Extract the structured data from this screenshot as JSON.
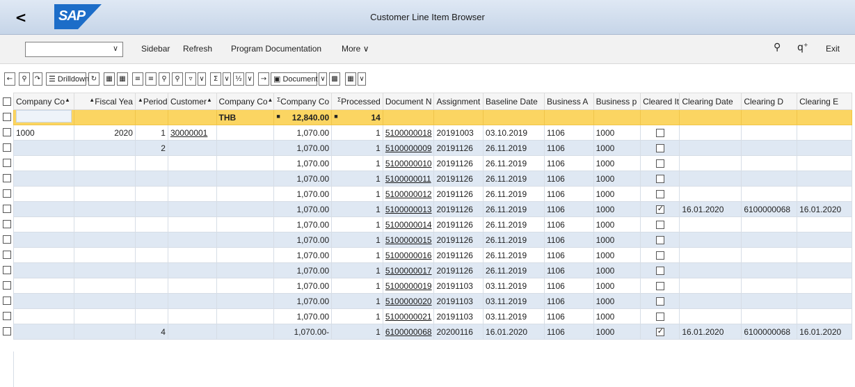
{
  "titlebar": {
    "back": "<",
    "logo": "SAP",
    "title": "Customer Line Item Browser"
  },
  "toolbar1": {
    "select_value": "",
    "sidebar": "Sidebar",
    "refresh": "Refresh",
    "program_doc": "Program Documentation",
    "more": "More",
    "exit": "Exit"
  },
  "toolbar2": {
    "drilldown": "Drilldown",
    "document": "Document"
  },
  "columns": [
    "Company Co",
    "Fiscal Yea",
    "Period",
    "Customer",
    "Company Co",
    "Company Co",
    "Processed",
    "Document N",
    "Assignment",
    "Baseline Date",
    "Business A",
    "Business p",
    "Cleared It",
    "Clearing Date",
    "Clearing D",
    "Clearing E"
  ],
  "total": {
    "currency": "THB",
    "amount": "12,840.00",
    "processed": "14"
  },
  "rows": [
    {
      "cc": "1000",
      "fy": "2020",
      "per": "1",
      "cust": "30000001",
      "amt": "1,070.00",
      "proc": "1",
      "doc": "5100000018",
      "asg": "20191003",
      "base": "03.10.2019",
      "ba": "1106",
      "bp": "1000",
      "cleared": false,
      "cdate": "",
      "cdoc": "",
      "cend": ""
    },
    {
      "cc": "",
      "fy": "",
      "per": "2",
      "cust": "",
      "amt": "1,070.00",
      "proc": "1",
      "doc": "5100000009",
      "asg": "20191126",
      "base": "26.11.2019",
      "ba": "1106",
      "bp": "1000",
      "cleared": false,
      "cdate": "",
      "cdoc": "",
      "cend": ""
    },
    {
      "cc": "",
      "fy": "",
      "per": "",
      "cust": "",
      "amt": "1,070.00",
      "proc": "1",
      "doc": "5100000010",
      "asg": "20191126",
      "base": "26.11.2019",
      "ba": "1106",
      "bp": "1000",
      "cleared": false,
      "cdate": "",
      "cdoc": "",
      "cend": ""
    },
    {
      "cc": "",
      "fy": "",
      "per": "",
      "cust": "",
      "amt": "1,070.00",
      "proc": "1",
      "doc": "5100000011",
      "asg": "20191126",
      "base": "26.11.2019",
      "ba": "1106",
      "bp": "1000",
      "cleared": false,
      "cdate": "",
      "cdoc": "",
      "cend": ""
    },
    {
      "cc": "",
      "fy": "",
      "per": "",
      "cust": "",
      "amt": "1,070.00",
      "proc": "1",
      "doc": "5100000012",
      "asg": "20191126",
      "base": "26.11.2019",
      "ba": "1106",
      "bp": "1000",
      "cleared": false,
      "cdate": "",
      "cdoc": "",
      "cend": ""
    },
    {
      "cc": "",
      "fy": "",
      "per": "",
      "cust": "",
      "amt": "1,070.00",
      "proc": "1",
      "doc": "5100000013",
      "asg": "20191126",
      "base": "26.11.2019",
      "ba": "1106",
      "bp": "1000",
      "cleared": true,
      "cdate": "16.01.2020",
      "cdoc": "6100000068",
      "cend": "16.01.2020"
    },
    {
      "cc": "",
      "fy": "",
      "per": "",
      "cust": "",
      "amt": "1,070.00",
      "proc": "1",
      "doc": "5100000014",
      "asg": "20191126",
      "base": "26.11.2019",
      "ba": "1106",
      "bp": "1000",
      "cleared": false,
      "cdate": "",
      "cdoc": "",
      "cend": ""
    },
    {
      "cc": "",
      "fy": "",
      "per": "",
      "cust": "",
      "amt": "1,070.00",
      "proc": "1",
      "doc": "5100000015",
      "asg": "20191126",
      "base": "26.11.2019",
      "ba": "1106",
      "bp": "1000",
      "cleared": false,
      "cdate": "",
      "cdoc": "",
      "cend": ""
    },
    {
      "cc": "",
      "fy": "",
      "per": "",
      "cust": "",
      "amt": "1,070.00",
      "proc": "1",
      "doc": "5100000016",
      "asg": "20191126",
      "base": "26.11.2019",
      "ba": "1106",
      "bp": "1000",
      "cleared": false,
      "cdate": "",
      "cdoc": "",
      "cend": ""
    },
    {
      "cc": "",
      "fy": "",
      "per": "",
      "cust": "",
      "amt": "1,070.00",
      "proc": "1",
      "doc": "5100000017",
      "asg": "20191126",
      "base": "26.11.2019",
      "ba": "1106",
      "bp": "1000",
      "cleared": false,
      "cdate": "",
      "cdoc": "",
      "cend": ""
    },
    {
      "cc": "",
      "fy": "",
      "per": "",
      "cust": "",
      "amt": "1,070.00",
      "proc": "1",
      "doc": "5100000019",
      "asg": "20191103",
      "base": "03.11.2019",
      "ba": "1106",
      "bp": "1000",
      "cleared": false,
      "cdate": "",
      "cdoc": "",
      "cend": ""
    },
    {
      "cc": "",
      "fy": "",
      "per": "",
      "cust": "",
      "amt": "1,070.00",
      "proc": "1",
      "doc": "5100000020",
      "asg": "20191103",
      "base": "03.11.2019",
      "ba": "1106",
      "bp": "1000",
      "cleared": false,
      "cdate": "",
      "cdoc": "",
      "cend": ""
    },
    {
      "cc": "",
      "fy": "",
      "per": "",
      "cust": "",
      "amt": "1,070.00",
      "proc": "1",
      "doc": "5100000021",
      "asg": "20191103",
      "base": "03.11.2019",
      "ba": "1106",
      "bp": "1000",
      "cleared": false,
      "cdate": "",
      "cdoc": "",
      "cend": ""
    },
    {
      "cc": "",
      "fy": "",
      "per": "4",
      "cust": "",
      "amt": "1,070.00-",
      "proc": "1",
      "doc": "6100000068",
      "asg": "20200116",
      "base": "16.01.2020",
      "ba": "1106",
      "bp": "1000",
      "cleared": true,
      "cdate": "16.01.2020",
      "cdoc": "6100000068",
      "cend": "16.01.2020"
    }
  ]
}
